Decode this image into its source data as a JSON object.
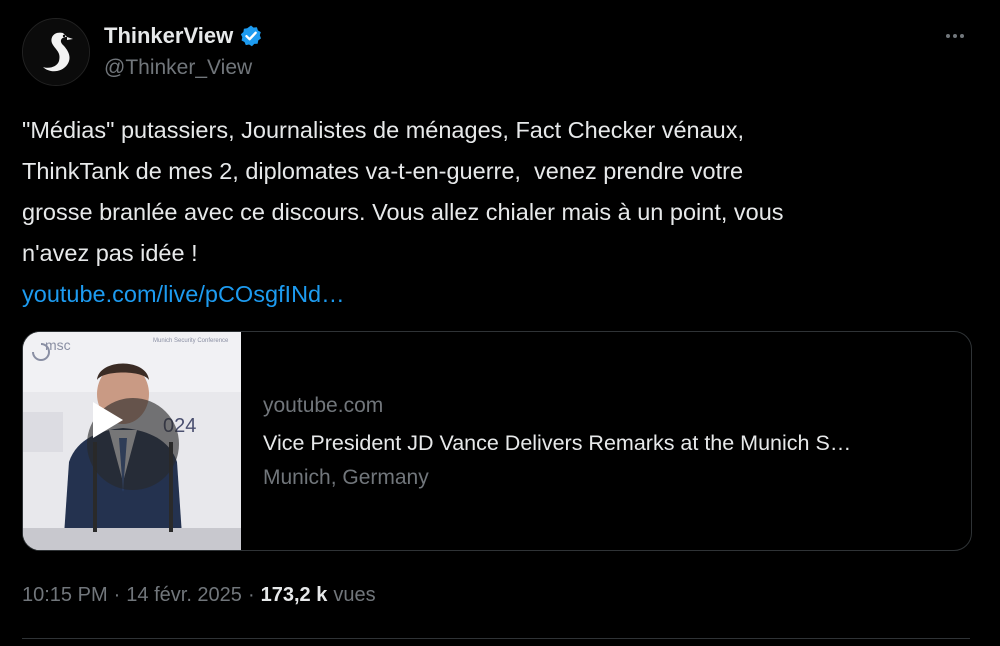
{
  "author": {
    "display_name": "ThinkerView",
    "handle": "@Thinker_View",
    "avatar_icon": "swan-logo-icon",
    "verified_icon": "verified-badge-icon",
    "verified_color": "#1d9bf0"
  },
  "more_icon": "more-options-icon",
  "tweet": {
    "text": "\"Médias\" putassiers, Journalistes de ménages, Fact Checker vénaux,\nThinkTank de mes 2, diplomates va-t-en-guerre,  venez prendre votre\ngrosse branlée avec ce discours. Vous allez chialer mais à un point, vous\nn'avez pas idée !",
    "link": "youtube.com/live/pCOsgfINd…"
  },
  "card": {
    "thumbnail_icon": "video-thumbnail",
    "play_icon": "play-icon",
    "thumb_text": {
      "org": "msc",
      "conference": "Munich Security Conference",
      "year": "024"
    },
    "domain": "youtube.com",
    "title": "Vice President JD Vance Delivers Remarks at the Munich S…",
    "description": "Munich, Germany"
  },
  "meta": {
    "time": "10:15 PM",
    "separator": "·",
    "date": "14 févr. 2025",
    "views": "173,2 k",
    "views_label": "vues"
  },
  "colors": {
    "background": "#000000",
    "text": "#e7e9ea",
    "muted": "#71767b",
    "link": "#1d9bf0",
    "border": "#2f3336"
  }
}
